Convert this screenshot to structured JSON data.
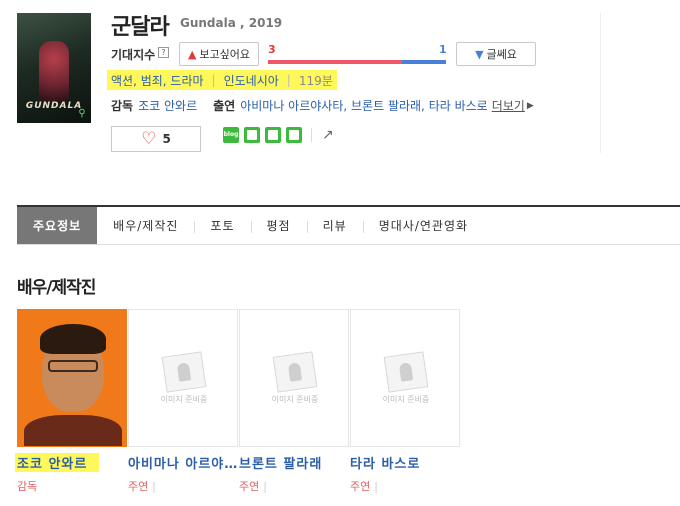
{
  "movie": {
    "title": "군달라",
    "subtitle": "Gundala , 2019",
    "poster_text": "GUNDALA",
    "genres": "액션, 범죄, 드라마",
    "country": "인도네시아",
    "runtime": "119분"
  },
  "expectation": {
    "label": "기대지수",
    "help": "?",
    "want_label": "보고싶어요",
    "meh_label": "글쎄요",
    "want_count": "3",
    "meh_count": "1",
    "want_ratio": 0.75
  },
  "credits": {
    "director_label": "감독",
    "director": "조코 안와르",
    "cast_label": "출연",
    "cast": "아비마나 아르야사타, 브론트 팔라래, 타라 바스로",
    "more_label": "더보기"
  },
  "like": {
    "count": "5"
  },
  "share": {
    "blog": "blog"
  },
  "tabs": [
    "주요정보",
    "배우/제작진",
    "포토",
    "평점",
    "리뷰",
    "명대사/연관영화"
  ],
  "section": {
    "title": "배우/제작진"
  },
  "cast_list": [
    {
      "name": "조코 안와르",
      "role": "감독"
    },
    {
      "name": "아비마나 아르야사타",
      "role": "주연"
    },
    {
      "name": "브론트 팔라래",
      "role": "주연"
    },
    {
      "name": "타라 바스로",
      "role": "주연"
    }
  ],
  "placeholder": {
    "text": "이미지 준비중"
  },
  "colors": {
    "accent_red": "#e23a3a",
    "accent_blue": "#4a7fd9",
    "highlight": "#fff85a",
    "link": "#2a5ea8"
  }
}
